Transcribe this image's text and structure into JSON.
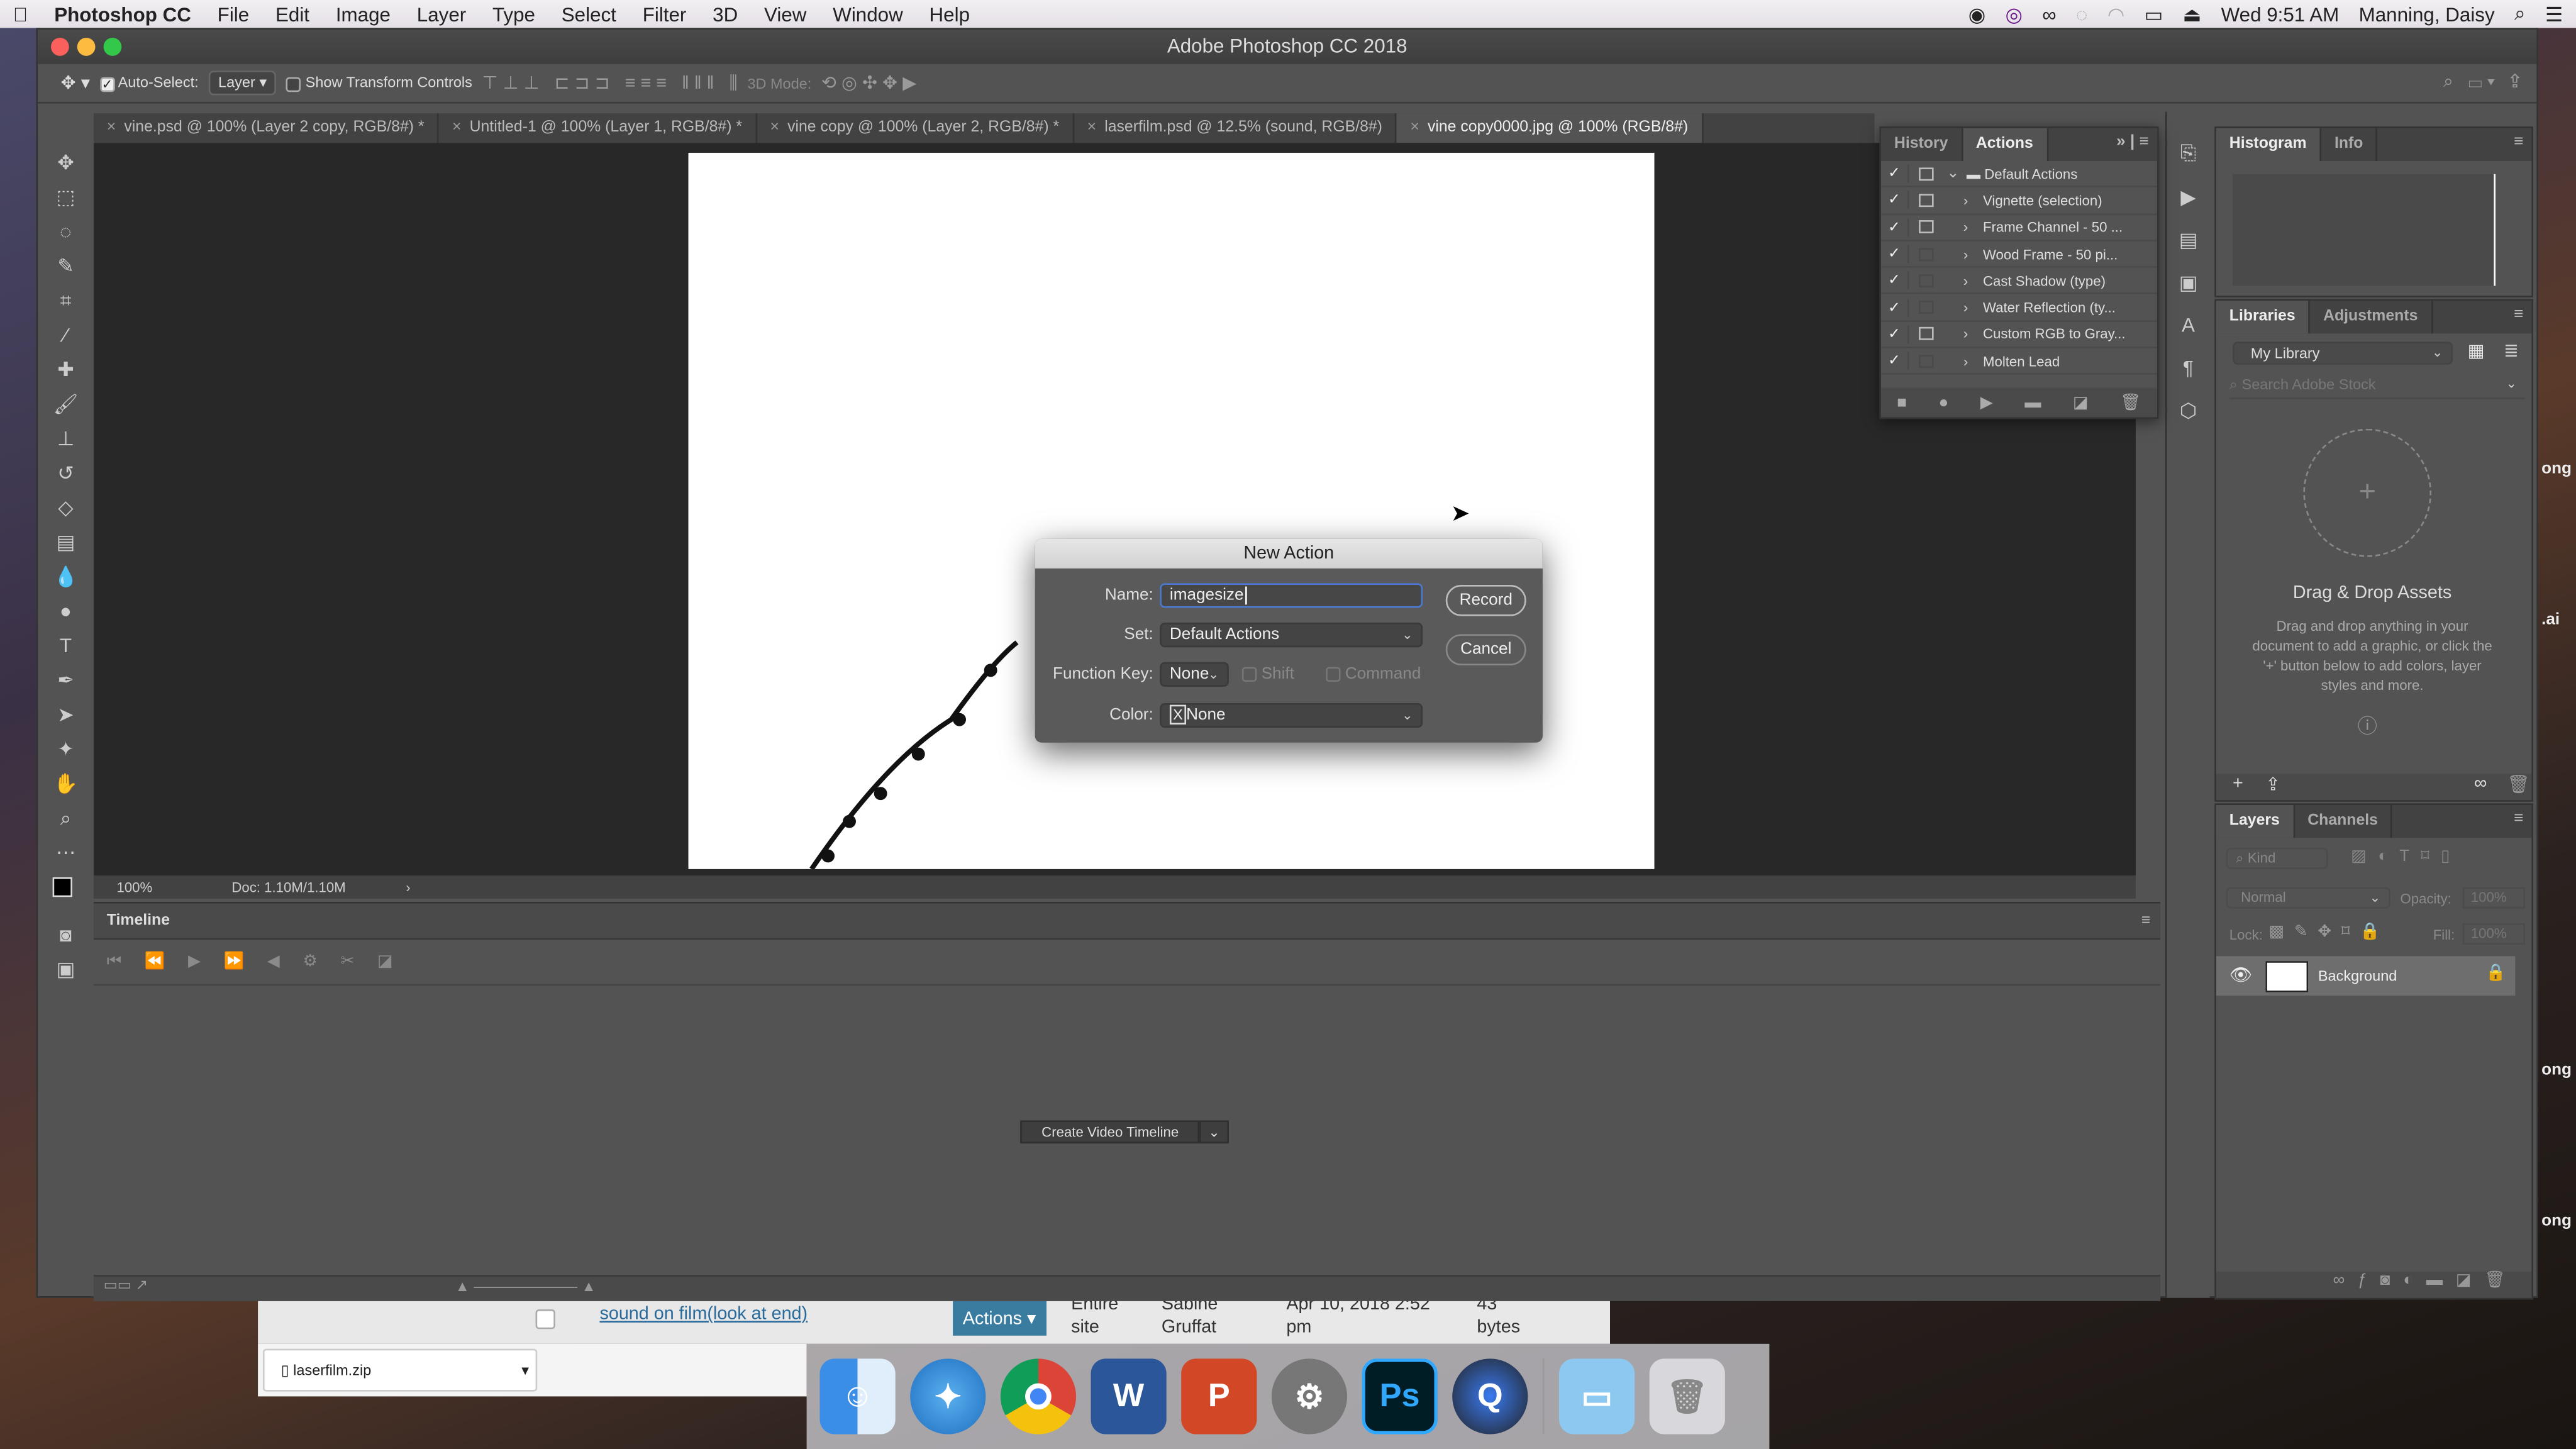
{
  "menubar": {
    "app": "Photoshop CC",
    "items": [
      "File",
      "Edit",
      "Image",
      "Layer",
      "Type",
      "Select",
      "Filter",
      "3D",
      "View",
      "Window",
      "Help"
    ],
    "clock": "Wed 9:51 AM",
    "user": "Manning, Daisy"
  },
  "window": {
    "title": "Adobe Photoshop CC 2018"
  },
  "options": {
    "auto_select_label": "Auto-Select:",
    "auto_select_checked": true,
    "auto_select_value": "Layer",
    "show_transform_label": "Show Transform Controls",
    "mode_3d_label": "3D Mode:"
  },
  "tabs": [
    {
      "label": "vine.psd @ 100% (Layer 2 copy, RGB/8#) *"
    },
    {
      "label": "Untitled-1 @ 100% (Layer 1, RGB/8#) *"
    },
    {
      "label": "vine copy @ 100% (Layer 2, RGB/8#) *"
    },
    {
      "label": "laserfilm.psd @ 12.5% (sound, RGB/8#)"
    },
    {
      "label": "vine copy0000.jpg @ 100% (RGB/8#)",
      "active": true
    }
  ],
  "status": {
    "zoom": "100%",
    "doc": "Doc: 1.10M/1.10M"
  },
  "timeline": {
    "title": "Timeline",
    "create_button": "Create Video Timeline"
  },
  "actions_panel": {
    "tabs": [
      "History",
      "Actions"
    ],
    "active_tab": "Actions",
    "items": [
      {
        "label": "Default Actions",
        "dialog": true,
        "set": true
      },
      {
        "label": "Vignette (selection)",
        "dialog": true
      },
      {
        "label": "Frame Channel - 50 ...",
        "dialog": true
      },
      {
        "label": "Wood Frame - 50 pi...",
        "dialog": false
      },
      {
        "label": "Cast Shadow (type)",
        "dialog": false
      },
      {
        "label": "Water Reflection (ty...",
        "dialog": false
      },
      {
        "label": "Custom RGB to Gray...",
        "dialog": true
      },
      {
        "label": "Molten Lead",
        "dialog": false
      }
    ]
  },
  "histogram_panel": {
    "tabs": [
      "Histogram",
      "Info"
    ]
  },
  "libraries_panel": {
    "tabs": [
      "Libraries",
      "Adjustments"
    ],
    "library": "My Library",
    "search_placeholder": "Search Adobe Stock",
    "empty_title": "Drag & Drop Assets",
    "empty_text": "Drag and drop anything in your document to add a graphic, or click the '+' button below to add colors, layer styles and more."
  },
  "layers_panel": {
    "tabs": [
      "Layers",
      "Channels"
    ],
    "filter": "Kind",
    "blend_mode": "Normal",
    "opacity_label": "Opacity:",
    "opacity": "100%",
    "lock_label": "Lock:",
    "fill_label": "Fill:",
    "fill": "100%",
    "layers": [
      {
        "name": "Background",
        "visible": true,
        "locked": true
      }
    ]
  },
  "dialog": {
    "title": "New Action",
    "name_label": "Name:",
    "name_value": "imagesize",
    "set_label": "Set:",
    "set_value": "Default Actions",
    "fkey_label": "Function Key:",
    "fkey_value": "None",
    "shift_label": "Shift",
    "command_label": "Command",
    "color_label": "Color:",
    "color_value": "None",
    "record": "Record",
    "cancel": "Cancel"
  },
  "background_page": {
    "link": "sound on film(look at end)",
    "actions_btn": "Actions",
    "col1": "Entire site",
    "col2": "Sabine Gruffat",
    "col3": "Apr 10, 2018 2:52 pm",
    "col4": "43 bytes",
    "download": "laserfilm.zip",
    "fragments": [
      "ong",
      ".ai",
      "ong",
      "ong"
    ]
  },
  "dock": [
    "Finder",
    "Safari",
    "Chrome",
    "Word",
    "PowerPoint",
    "System Preferences",
    "Ps",
    "QuickTime",
    "Folder",
    "Trash"
  ]
}
